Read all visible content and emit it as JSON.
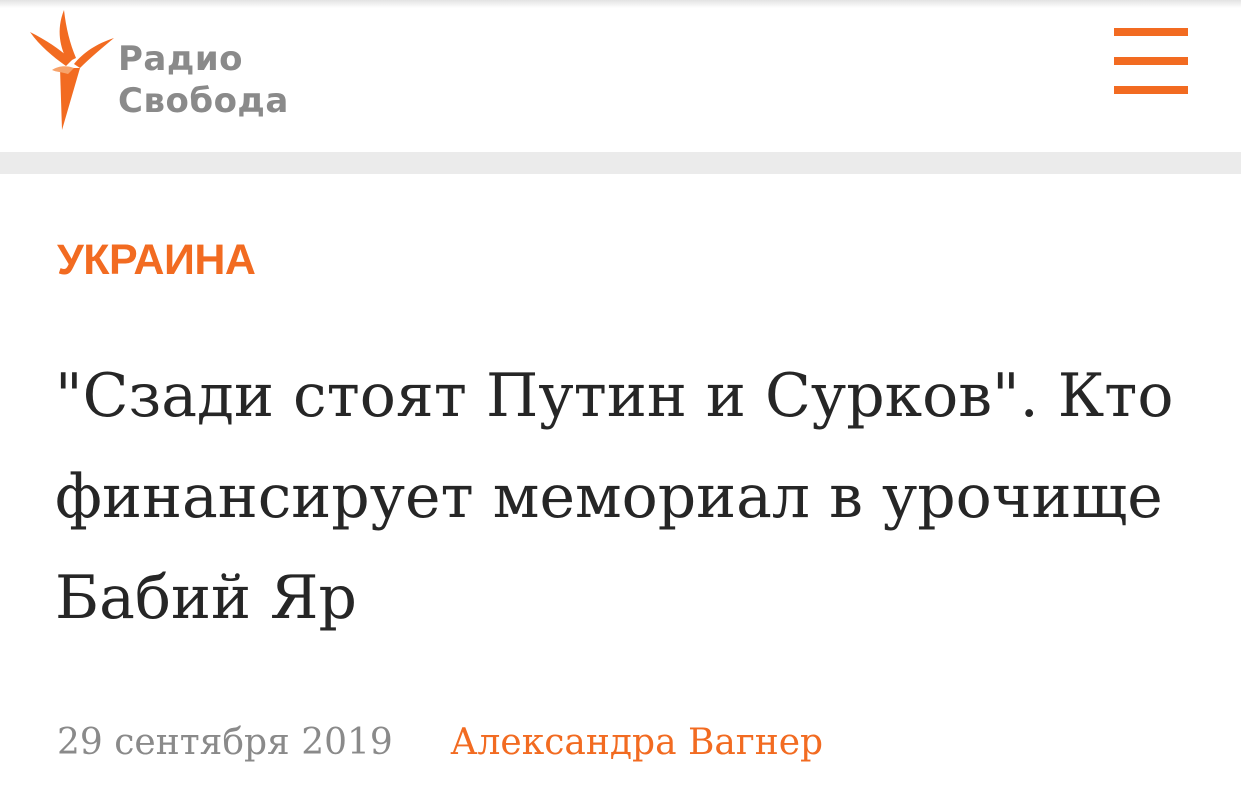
{
  "header": {
    "logo": {
      "line1": "Радио",
      "line2": "Свобода",
      "icon": "torch-flame-logo-icon"
    },
    "menu_icon": "hamburger-menu-icon"
  },
  "article": {
    "section": "УКРАИНА",
    "headline": "\"Сзади стоят Путин и Сурков\". Кто финансирует мемориал в урочище Бабий Яр",
    "date": "29 сентября 2019",
    "author": "Александра Вагнер"
  },
  "colors": {
    "accent": "#f26b21",
    "logo_gray": "#8a8a8a",
    "headline": "#262626",
    "divider": "#ebebeb"
  }
}
